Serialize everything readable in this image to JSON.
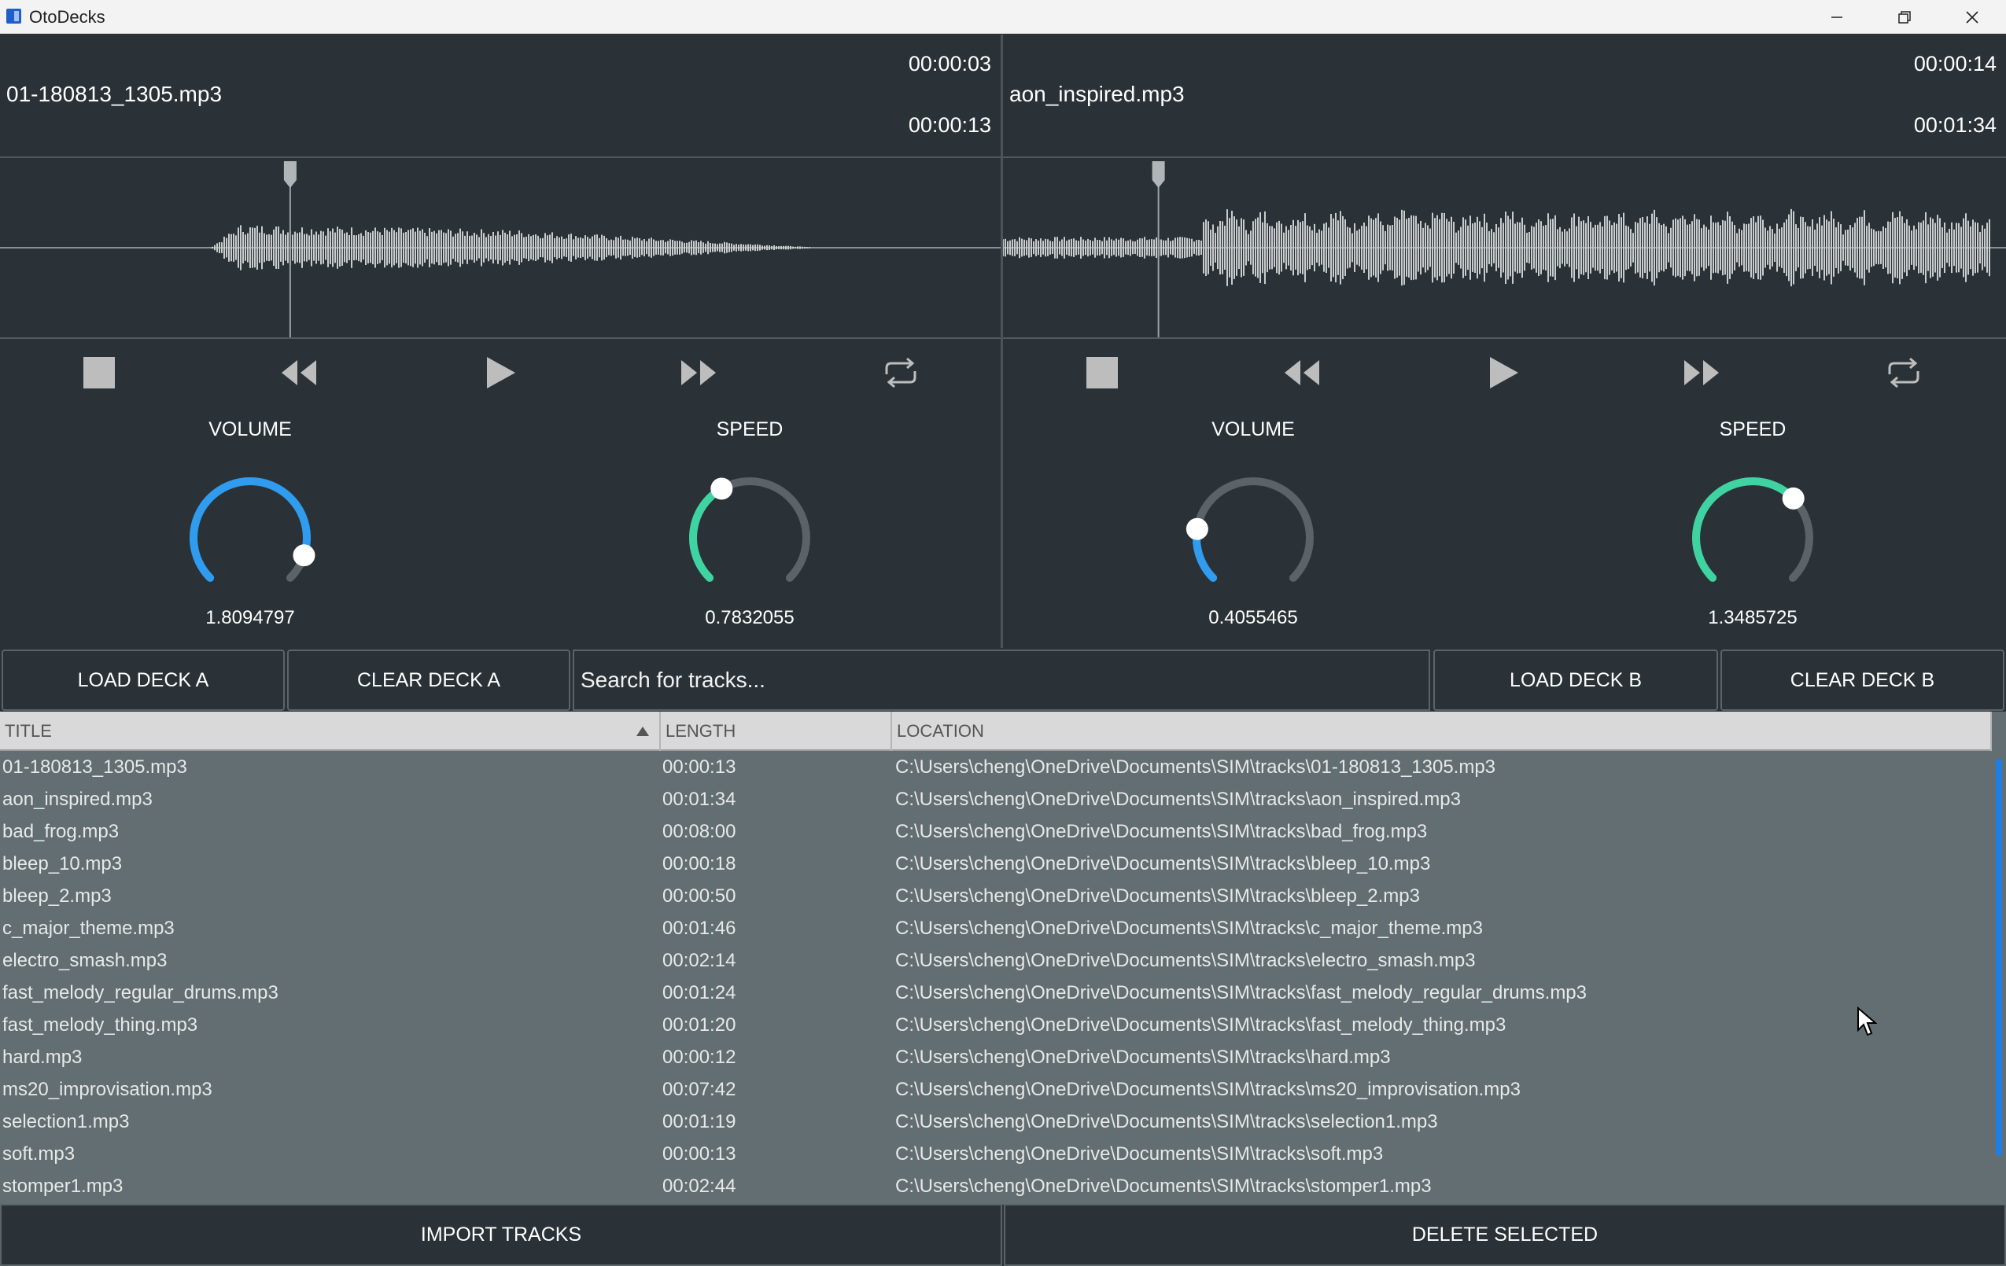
{
  "window": {
    "title": "OtoDecks"
  },
  "colors": {
    "accent_blue": "#2f9cf0",
    "accent_green": "#3ed3a0",
    "knob_track": "#5b6368",
    "panel": "#2a3237",
    "table_bg": "#626e71"
  },
  "deck_a": {
    "track": "01-180813_1305.mp3",
    "elapsed": "00:00:03",
    "length": "00:00:13",
    "playhead_fraction": 0.29,
    "volume_label": "VOLUME",
    "volume_value": "1.8094797",
    "volume_level": 0.9,
    "speed_label": "SPEED",
    "speed_value": "0.7832055",
    "speed_level": 0.39
  },
  "deck_b": {
    "track": "aon_inspired.mp3",
    "elapsed": "00:00:14",
    "length": "00:01:34",
    "playhead_fraction": 0.155,
    "volume_label": "VOLUME",
    "volume_value": "0.4055465",
    "volume_level": 0.2,
    "speed_label": "SPEED",
    "speed_value": "1.3485725",
    "speed_level": 0.67
  },
  "transport_icons": [
    "stop-icon",
    "rewind-icon",
    "play-icon",
    "fast-forward-icon",
    "loop-icon"
  ],
  "controls": {
    "load_a": "LOAD DECK A",
    "clear_a": "CLEAR DECK A",
    "search_placeholder": "Search for tracks...",
    "load_b": "LOAD DECK B",
    "clear_b": "CLEAR DECK B"
  },
  "table": {
    "headers": {
      "title": "TITLE",
      "length": "LENGTH",
      "location": "LOCATION"
    },
    "sort_icon": "sort-ascending-icon",
    "rows": [
      {
        "title": "01-180813_1305.mp3",
        "length": "00:00:13",
        "location": "C:\\Users\\cheng\\OneDrive\\Documents\\SIM\\tracks\\01-180813_1305.mp3"
      },
      {
        "title": "aon_inspired.mp3",
        "length": "00:01:34",
        "location": "C:\\Users\\cheng\\OneDrive\\Documents\\SIM\\tracks\\aon_inspired.mp3"
      },
      {
        "title": "bad_frog.mp3",
        "length": "00:08:00",
        "location": "C:\\Users\\cheng\\OneDrive\\Documents\\SIM\\tracks\\bad_frog.mp3"
      },
      {
        "title": "bleep_10.mp3",
        "length": "00:00:18",
        "location": "C:\\Users\\cheng\\OneDrive\\Documents\\SIM\\tracks\\bleep_10.mp3"
      },
      {
        "title": "bleep_2.mp3",
        "length": "00:00:50",
        "location": "C:\\Users\\cheng\\OneDrive\\Documents\\SIM\\tracks\\bleep_2.mp3"
      },
      {
        "title": "c_major_theme.mp3",
        "length": "00:01:46",
        "location": "C:\\Users\\cheng\\OneDrive\\Documents\\SIM\\tracks\\c_major_theme.mp3"
      },
      {
        "title": "electro_smash.mp3",
        "length": "00:02:14",
        "location": "C:\\Users\\cheng\\OneDrive\\Documents\\SIM\\tracks\\electro_smash.mp3"
      },
      {
        "title": "fast_melody_regular_drums.mp3",
        "length": "00:01:24",
        "location": "C:\\Users\\cheng\\OneDrive\\Documents\\SIM\\tracks\\fast_melody_regular_drums.mp3"
      },
      {
        "title": "fast_melody_thing.mp3",
        "length": "00:01:20",
        "location": "C:\\Users\\cheng\\OneDrive\\Documents\\SIM\\tracks\\fast_melody_thing.mp3"
      },
      {
        "title": "hard.mp3",
        "length": "00:00:12",
        "location": "C:\\Users\\cheng\\OneDrive\\Documents\\SIM\\tracks\\hard.mp3"
      },
      {
        "title": "ms20_improvisation.mp3",
        "length": "00:07:42",
        "location": "C:\\Users\\cheng\\OneDrive\\Documents\\SIM\\tracks\\ms20_improvisation.mp3"
      },
      {
        "title": "selection1.mp3",
        "length": "00:01:19",
        "location": "C:\\Users\\cheng\\OneDrive\\Documents\\SIM\\tracks\\selection1.mp3"
      },
      {
        "title": "soft.mp3",
        "length": "00:00:13",
        "location": "C:\\Users\\cheng\\OneDrive\\Documents\\SIM\\tracks\\soft.mp3"
      },
      {
        "title": "stomper1.mp3",
        "length": "00:02:44",
        "location": "C:\\Users\\cheng\\OneDrive\\Documents\\SIM\\tracks\\stomper1.mp3"
      }
    ]
  },
  "bottom": {
    "import": "IMPORT TRACKS",
    "delete": "DELETE SELECTED"
  }
}
